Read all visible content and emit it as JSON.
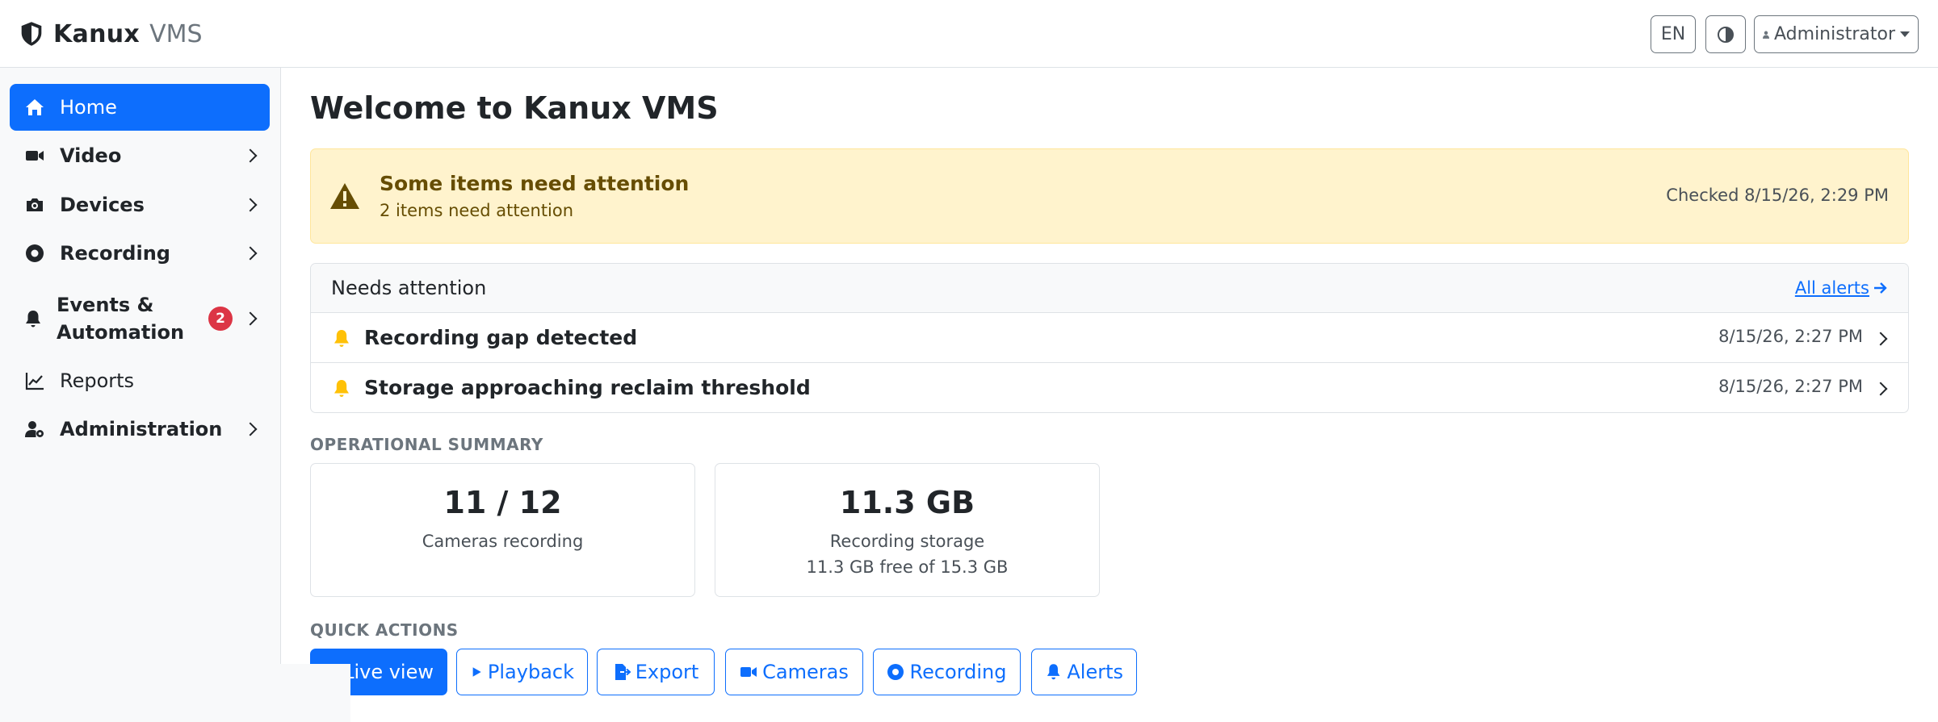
{
  "brand": {
    "name": "Kanux",
    "product": "VMS"
  },
  "topbar": {
    "language": "EN",
    "theme_icon": "half-circle-icon",
    "user": "Administrator"
  },
  "sidebar": {
    "items": [
      {
        "label": "Home",
        "icon": "home-icon",
        "active": true
      },
      {
        "label": "Video",
        "icon": "video-camera-icon"
      },
      {
        "label": "Devices",
        "icon": "camera-icon"
      },
      {
        "label": "Recording",
        "icon": "record-icon"
      },
      {
        "label": "Events & Automation",
        "icon": "bell-icon",
        "badge": "2"
      },
      {
        "label": "Reports",
        "icon": "chart-line-icon"
      },
      {
        "label": "Administration",
        "icon": "user-gear-icon"
      }
    ]
  },
  "main": {
    "title": "Welcome to Kanux VMS",
    "alert": {
      "title": "Some items need attention",
      "text": "2 items need attention",
      "checked": "Checked 8/15/26, 2:29 PM"
    },
    "attention": {
      "title": "Needs attention",
      "link": "All alerts",
      "rows": [
        {
          "title": "Recording gap detected",
          "time": "8/15/26, 2:27 PM"
        },
        {
          "title": "Storage approaching reclaim threshold",
          "time": "8/15/26, 2:27 PM"
        }
      ]
    },
    "summary": {
      "label": "OPERATIONAL SUMMARY",
      "cards": [
        {
          "value": "11 / 12",
          "label": "Cameras recording",
          "sub": ""
        },
        {
          "value": "11.3 GB",
          "label": "Recording storage",
          "sub": "11.3 GB free of 15.3 GB"
        }
      ]
    },
    "quick_actions": {
      "label": "QUICK ACTIONS",
      "buttons": [
        "Live view",
        "Playback",
        "Export",
        "Cameras",
        "Recording",
        "Alerts"
      ]
    }
  },
  "colors": {
    "primary": "#0d6efd",
    "warning_bg": "#fff3cd",
    "warning_text": "#664d03",
    "danger": "#dc3545",
    "bell": "#ffc107"
  }
}
